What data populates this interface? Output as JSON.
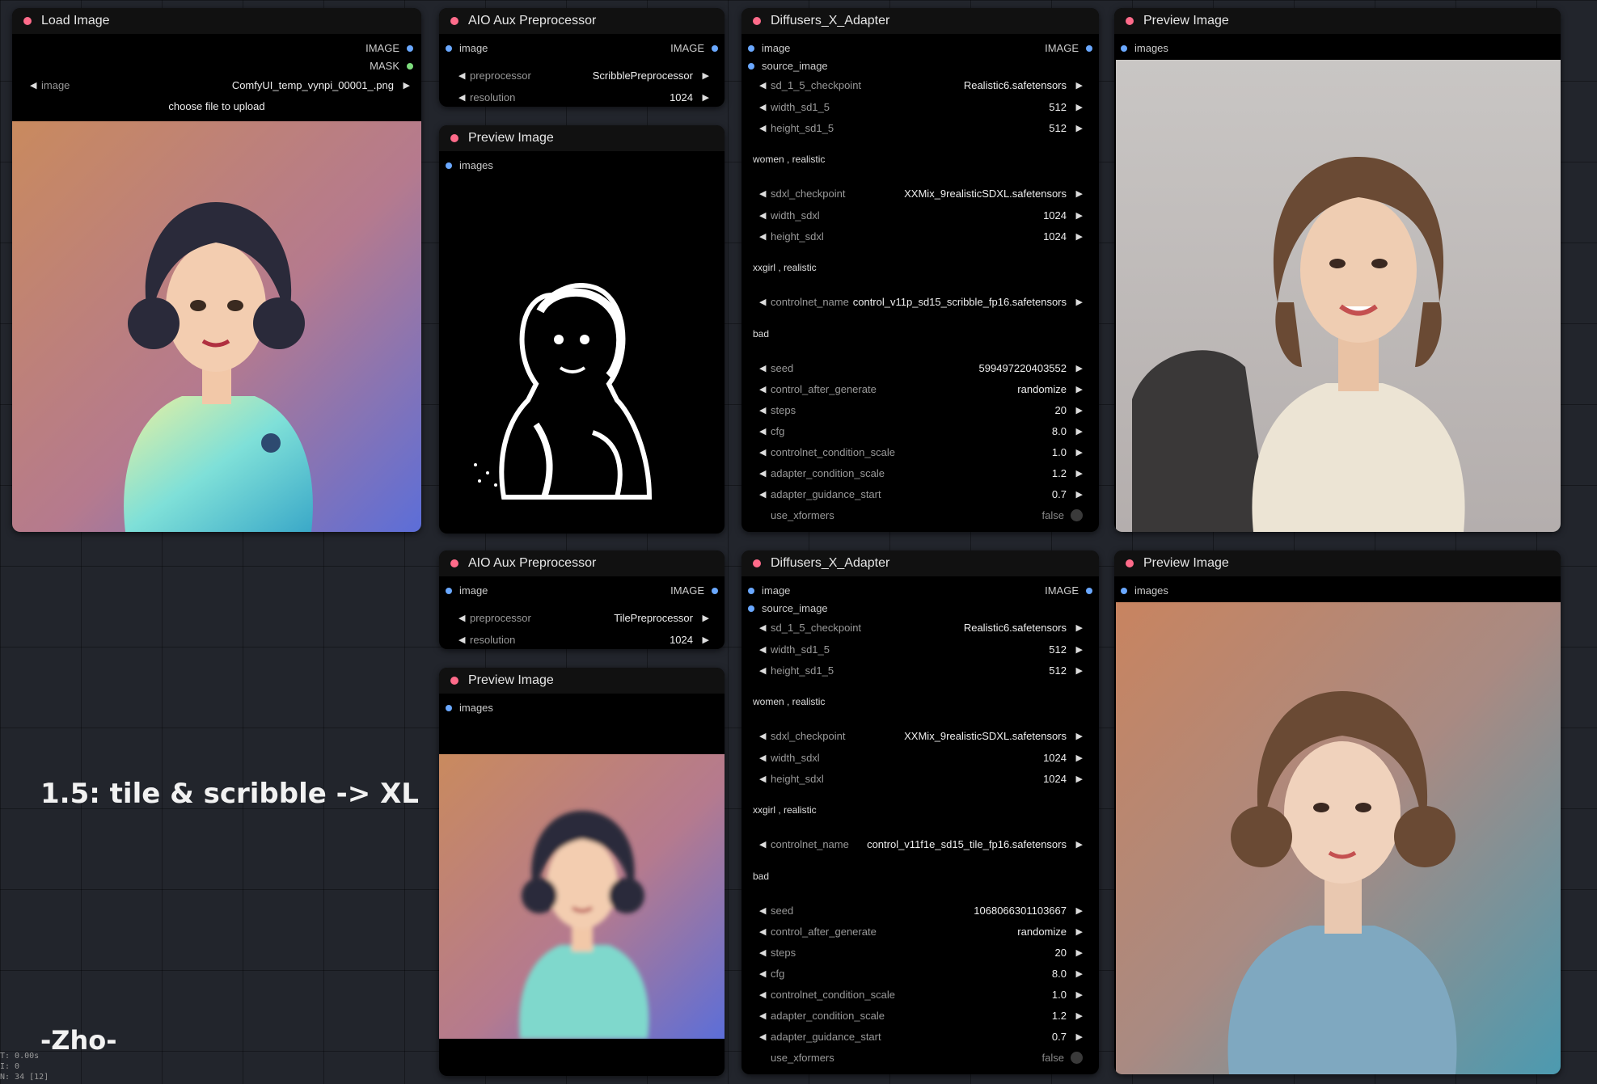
{
  "load_image": {
    "title": "Load Image",
    "out_image": "IMAGE",
    "out_mask": "MASK",
    "widget_label": "image",
    "widget_value": "ComfyUI_temp_vynpi_00001_.png",
    "upload_label": "choose file to upload"
  },
  "aux1": {
    "title": "AIO Aux Preprocessor",
    "in_image": "image",
    "out_image": "IMAGE",
    "preprocessor_label": "preprocessor",
    "preprocessor_value": "ScribblePreprocessor",
    "resolution_label": "resolution",
    "resolution_value": "1024"
  },
  "aux2": {
    "title": "AIO Aux Preprocessor",
    "in_image": "image",
    "out_image": "IMAGE",
    "preprocessor_label": "preprocessor",
    "preprocessor_value": "TilePreprocessor",
    "resolution_label": "resolution",
    "resolution_value": "1024"
  },
  "preview_scribble": {
    "title": "Preview Image",
    "in_images": "images"
  },
  "preview_tile": {
    "title": "Preview Image",
    "in_images": "images"
  },
  "preview_out1": {
    "title": "Preview Image",
    "in_images": "images"
  },
  "preview_out2": {
    "title": "Preview Image",
    "in_images": "images"
  },
  "adapter1": {
    "title": "Diffusers_X_Adapter",
    "in_image": "image",
    "in_source": "source_image",
    "out_image": "IMAGE",
    "sd15_ckpt_label": "sd_1_5_checkpoint",
    "sd15_ckpt_value": "Realistic6.safetensors",
    "w15_label": "width_sd1_5",
    "w15_value": "512",
    "h15_label": "height_sd1_5",
    "h15_value": "512",
    "prompt_sd15": "women , realistic",
    "sdxl_ckpt_label": "sdxl_checkpoint",
    "sdxl_ckpt_value": "XXMix_9realisticSDXL.safetensors",
    "wxl_label": "width_sdxl",
    "wxl_value": "1024",
    "hxl_label": "height_sdxl",
    "hxl_value": "1024",
    "prompt_sdxl": "xxgirl , realistic",
    "cn_label": "controlnet_name",
    "cn_value": "control_v11p_sd15_scribble_fp16.safetensors",
    "negative": "bad",
    "seed_label": "seed",
    "seed_value": "599497220403552",
    "cag_label": "control_after_generate",
    "cag_value": "randomize",
    "steps_label": "steps",
    "steps_value": "20",
    "cfg_label": "cfg",
    "cfg_value": "8.0",
    "ccs_label": "controlnet_condition_scale",
    "ccs_value": "1.0",
    "acs_label": "adapter_condition_scale",
    "acs_value": "1.2",
    "ags_label": "adapter_guidance_start",
    "ags_value": "0.7",
    "xf_label": "use_xformers",
    "xf_value": "false"
  },
  "adapter2": {
    "title": "Diffusers_X_Adapter",
    "in_image": "image",
    "in_source": "source_image",
    "out_image": "IMAGE",
    "sd15_ckpt_label": "sd_1_5_checkpoint",
    "sd15_ckpt_value": "Realistic6.safetensors",
    "w15_label": "width_sd1_5",
    "w15_value": "512",
    "h15_label": "height_sd1_5",
    "h15_value": "512",
    "prompt_sd15": "women , realistic",
    "sdxl_ckpt_label": "sdxl_checkpoint",
    "sdxl_ckpt_value": "XXMix_9realisticSDXL.safetensors",
    "wxl_label": "width_sdxl",
    "wxl_value": "1024",
    "hxl_label": "height_sdxl",
    "hxl_value": "1024",
    "prompt_sdxl": "xxgirl , realistic",
    "cn_label": "controlnet_name",
    "cn_value": "control_v11f1e_sd15_tile_fp16.safetensors",
    "negative": "bad",
    "seed_label": "seed",
    "seed_value": "1068066301103667",
    "cag_label": "control_after_generate",
    "cag_value": "randomize",
    "steps_label": "steps",
    "steps_value": "20",
    "cfg_label": "cfg",
    "cfg_value": "8.0",
    "ccs_label": "controlnet_condition_scale",
    "ccs_value": "1.0",
    "acs_label": "adapter_condition_scale",
    "acs_value": "1.2",
    "ags_label": "adapter_guidance_start",
    "ags_value": "0.7",
    "xf_label": "use_xformers",
    "xf_value": "false"
  },
  "canvas_note": "1.5:  tile & scribble -> XL",
  "author": "-Zho-",
  "stats": [
    "T: 0.00s",
    "I: 0",
    "N: 34 [12]"
  ],
  "colors": {
    "node_dot": "#ff6b8a",
    "socket_image": "#6aa8ff",
    "socket_mask": "#7ddc7d",
    "node_bg": "#000000",
    "canvas": "#22252c"
  },
  "icons": [
    "left-arrow-icon",
    "right-arrow-icon",
    "node-status-dot",
    "input-socket",
    "output-socket",
    "toggle-icon"
  ]
}
